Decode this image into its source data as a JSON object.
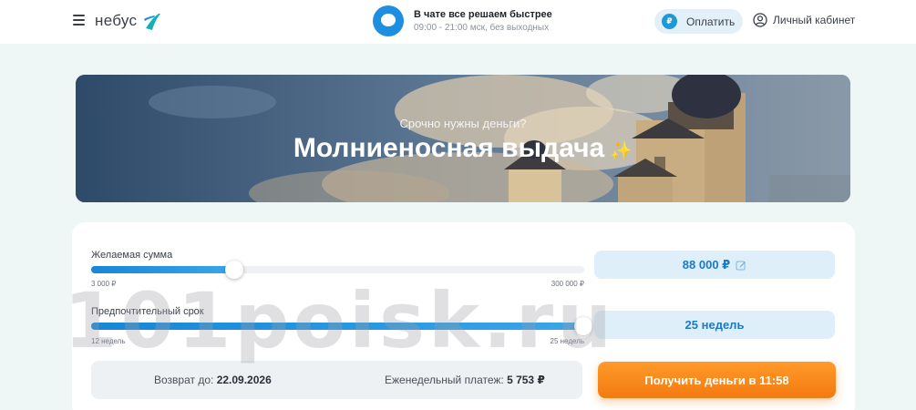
{
  "header": {
    "logo_text": "небус",
    "chat_title": "В чате все решаем быстрее",
    "chat_hours": "09:00 - 21:00 мск, без выходных",
    "pay_icon": "₽",
    "pay_label": "Оплатить",
    "account_label": "Личный кабинет"
  },
  "banner": {
    "subtitle": "Срочно нужны деньги?",
    "title": "Молниеносная выдача",
    "spark": "✨"
  },
  "calculator": {
    "amount": {
      "label": "Желаемая сумма",
      "min_label": "3 000 ₽",
      "max_label": "300 000 ₽",
      "value": "88 000 ₽",
      "fraction": 0.29
    },
    "term": {
      "label": "Предпочтительный срок",
      "min_label": "12 недель",
      "max_label": "25 недель",
      "value": "25 недель",
      "fraction": 1.0
    },
    "return_label": "Возврат до:",
    "return_date": "22.09.2026",
    "weekly_label": "Еженедельный платеж:",
    "weekly_value": "5 753 ₽",
    "cta_label": "Получить деньги в 11:58"
  },
  "watermark": "101poisk.ru",
  "colors": {
    "accent": "#1686d6",
    "cta": "#f37a10",
    "background": "#eef6f6"
  }
}
